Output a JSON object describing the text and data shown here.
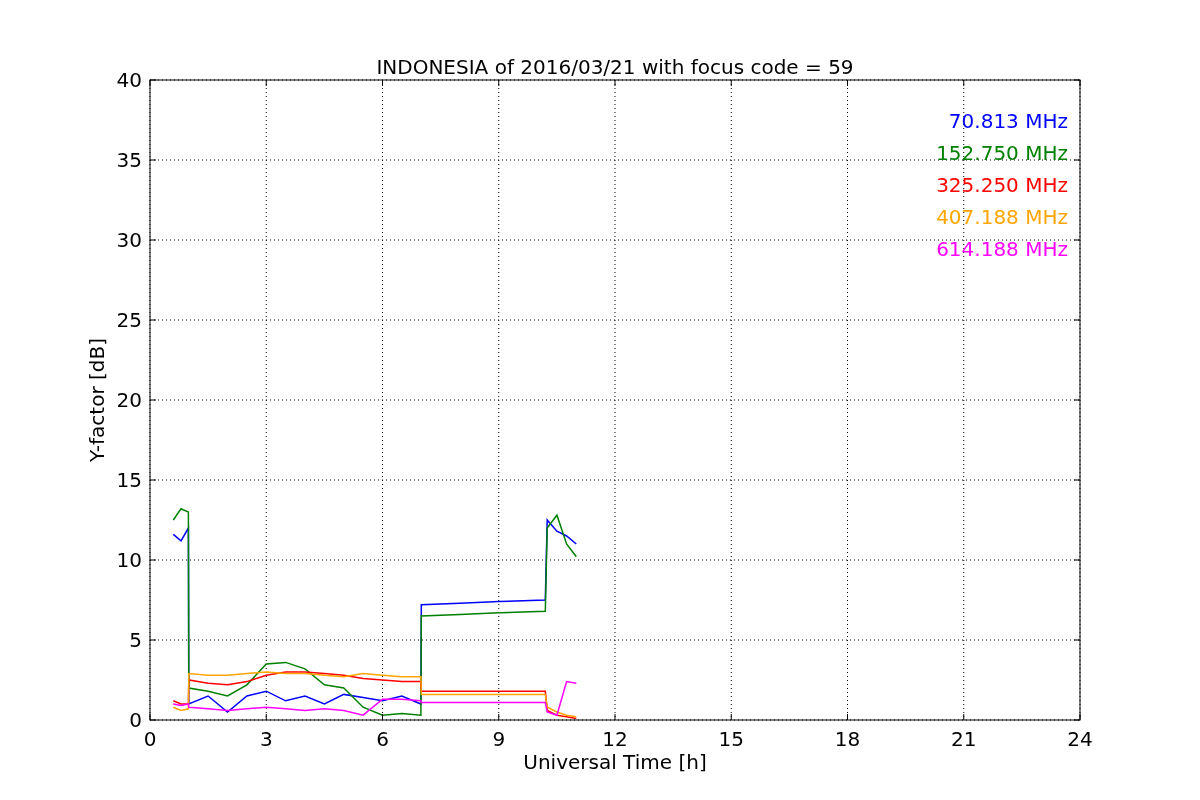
{
  "chart": {
    "chart_data": {
      "type": "line",
      "title": "INDONESIA of 2016/03/21 with focus code = 59",
      "xlabel": "Universal Time [h]",
      "ylabel": "Y-factor [dB]",
      "x": [
        0.6,
        0.8,
        0.99,
        1.0,
        1.5,
        2,
        2.5,
        3,
        3.5,
        4,
        4.5,
        5,
        5.5,
        6,
        6.5,
        6.99,
        7.0,
        8,
        9,
        10.2,
        10.25,
        10.5,
        10.75,
        11.0
      ],
      "series": [
        {
          "name": "70.813 MHz",
          "color": "#0000ff",
          "values": [
            11.6,
            11.2,
            12,
            1.0,
            1.5,
            0.5,
            1.5,
            1.8,
            1.2,
            1.5,
            1.0,
            1.6,
            1.4,
            1.2,
            1.5,
            1.0,
            7.2,
            7.3,
            7.4,
            7.5,
            12.5,
            11.8,
            11.5,
            11.0
          ]
        },
        {
          "name": "152.750 MHz",
          "color": "#008000",
          "values": [
            12.5,
            13.2,
            13,
            2.0,
            1.8,
            1.5,
            2.2,
            3.5,
            3.6,
            3.2,
            2.2,
            2.0,
            0.8,
            0.3,
            0.4,
            0.3,
            6.5,
            6.6,
            6.7,
            6.8,
            12,
            12.8,
            11,
            10.2
          ]
        },
        {
          "name": "325.250 MHz",
          "color": "#ff0000",
          "values": [
            1.2,
            1.0,
            1.0,
            2.5,
            2.3,
            2.2,
            2.4,
            2.8,
            3.0,
            3.0,
            2.9,
            2.8,
            2.6,
            2.5,
            2.4,
            2.4,
            1.8,
            1.8,
            1.8,
            1.8,
            0.6,
            0.3,
            0.2,
            0.1
          ]
        },
        {
          "name": "407.188 MHz",
          "color": "#ffa500",
          "values": [
            0.8,
            0.6,
            0.7,
            2.9,
            2.8,
            2.8,
            2.9,
            3.0,
            2.9,
            2.9,
            2.8,
            2.7,
            2.9,
            2.8,
            2.7,
            2.7,
            1.6,
            1.6,
            1.6,
            1.6,
            0.8,
            0.5,
            0.3,
            0.2
          ]
        },
        {
          "name": "614.188 MHz",
          "color": "#ff00ff",
          "values": [
            1.0,
            0.9,
            1.0,
            0.8,
            0.7,
            0.6,
            0.7,
            0.8,
            0.7,
            0.6,
            0.7,
            0.6,
            0.3,
            1.3,
            1.3,
            1.2,
            1.1,
            1.1,
            1.1,
            1.1,
            0.5,
            0.3,
            2.4,
            2.3
          ]
        }
      ],
      "grid": true,
      "xlim": [
        0,
        24
      ],
      "ylim": [
        0,
        40
      ],
      "xticks": [
        0,
        3,
        6,
        9,
        12,
        15,
        18,
        21,
        24
      ],
      "yticks": [
        0,
        5,
        10,
        15,
        20,
        25,
        30,
        35,
        40
      ]
    }
  }
}
